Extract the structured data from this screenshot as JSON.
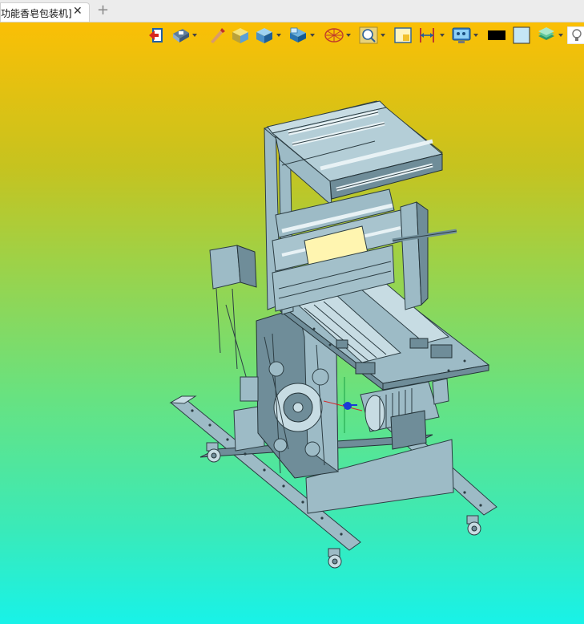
{
  "tab": {
    "title": "功能香皂包装机]",
    "close_glyph": "✕",
    "new_tab_glyph": "+"
  },
  "toolbar": {
    "items": [
      {
        "name": "exit-icon"
      },
      {
        "name": "view-icon",
        "dropdown": true
      },
      {
        "name": "measure-icon"
      },
      {
        "name": "shaded-box-icon"
      },
      {
        "name": "display-mode-icon",
        "dropdown": true
      },
      {
        "name": "section-icon",
        "dropdown": true
      },
      {
        "name": "explode-icon",
        "dropdown": true
      },
      {
        "name": "zoom-fit-icon",
        "dropdown": true
      },
      {
        "name": "frame-icon"
      },
      {
        "name": "dimension-icon",
        "dropdown": true
      },
      {
        "name": "screen-icon",
        "dropdown": true
      },
      {
        "name": "background-color-black-icon"
      },
      {
        "name": "background-color-light-icon"
      },
      {
        "name": "layers-icon",
        "dropdown": true
      },
      {
        "name": "light-icon"
      }
    ],
    "colors": {
      "black_swatch": "#000000",
      "light_swatch": "#c4e6f5"
    }
  },
  "viewport": {
    "background_top": "#fbbf05",
    "background_bottom": "#18f2e8"
  }
}
